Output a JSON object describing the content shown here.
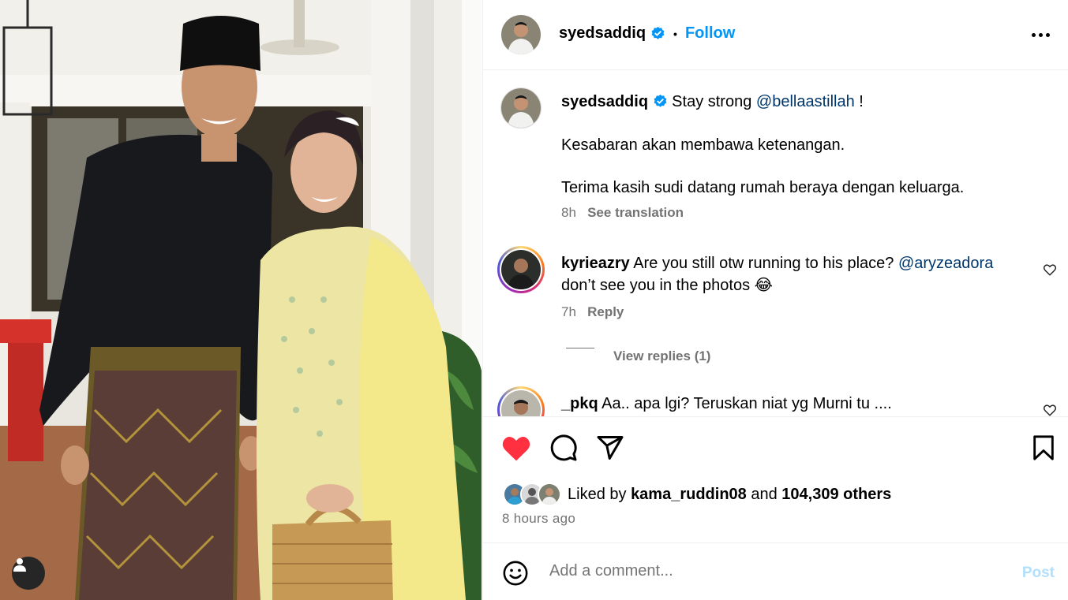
{
  "post": {
    "author": "syedsaddiq",
    "follow_label": "Follow",
    "separator": "•"
  },
  "caption": {
    "author": "syedsaddiq",
    "text_before": "Stay strong",
    "mention": "@bellaastillah",
    "text_after": "!",
    "line2": "Kesabaran akan membawa ketenangan.",
    "line3": "Terima kasih sudi datang rumah beraya dengan keluarga.",
    "time": "8h",
    "see_translation": "See translation"
  },
  "comments": [
    {
      "author": "kyrieazry",
      "text_before": "Are you still otw running to his place?",
      "mention": "@aryzeadora",
      "line2": "don’t see you in the photos",
      "emoji": "😂",
      "time": "7h",
      "reply_label": "Reply",
      "view_replies": "View replies (1)"
    },
    {
      "author": "_pkq",
      "text": "Aa.. apa lgi? Teruskan niat yg Murni tu ...."
    }
  ],
  "likes": {
    "prefix": "Liked by",
    "user": "kama_ruddin08",
    "middle": "and",
    "count": "104,309 others"
  },
  "posted_ago": "8 hours ago",
  "comment_box": {
    "placeholder": "Add a comment...",
    "post_label": "Post"
  },
  "colors": {
    "like_red": "#ff3040",
    "link_blue": "#0095f6",
    "mention_blue": "#00376b",
    "muted_gray": "#737373",
    "verified_blue": "#0095f6"
  },
  "icons": [
    "heart-filled-icon",
    "comment-icon",
    "share-icon",
    "bookmark-icon",
    "more-icon",
    "emoji-icon",
    "verified-icon",
    "heart-outline-icon",
    "user-tag-icon"
  ]
}
